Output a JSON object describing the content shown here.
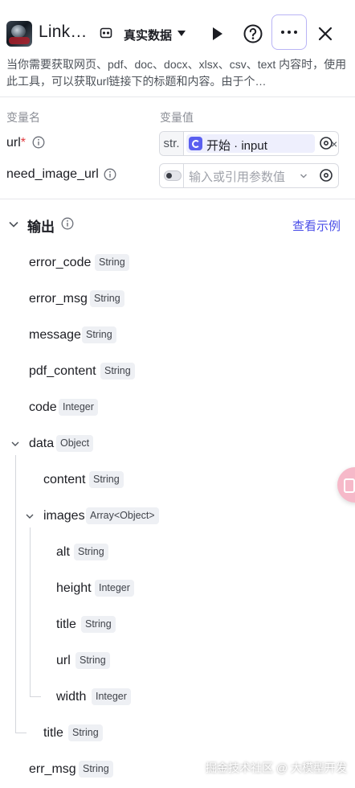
{
  "header": {
    "title": "Link…",
    "data_mode": "真实数据",
    "description": "当你需要获取网页、pdf、doc、docx、xlsx、csv、text 内容时，使用此工具，可以获取url链接下的标题和内容。由于个…"
  },
  "inputs": {
    "col_name": "变量名",
    "col_value": "变量值",
    "rows": [
      {
        "name": "url",
        "required": "*",
        "type_tag": "str.",
        "ref_text": "开始 · input",
        "clear": "×"
      },
      {
        "name": "need_image_url",
        "placeholder": "输入或引用参数值"
      }
    ]
  },
  "output": {
    "title": "输出",
    "see_example": "查看示例",
    "items": [
      {
        "name": "error_code",
        "type": "String"
      },
      {
        "name": "error_msg",
        "type": "String"
      },
      {
        "name": "message",
        "type": "String"
      },
      {
        "name": "pdf_content",
        "type": "String"
      },
      {
        "name": "code",
        "type": "Integer"
      },
      {
        "name": "data",
        "type": "Object"
      },
      {
        "name": "content",
        "type": "String"
      },
      {
        "name": "images",
        "type": "Array<Object>"
      },
      {
        "name": "alt",
        "type": "String"
      },
      {
        "name": "height",
        "type": "Integer"
      },
      {
        "name": "title",
        "type": "String"
      },
      {
        "name": "url",
        "type": "String"
      },
      {
        "name": "width",
        "type": "Integer"
      },
      {
        "name": "title",
        "type": "String"
      },
      {
        "name": "err_msg",
        "type": "String"
      }
    ]
  },
  "watermark": "掘金技术社区 @ 大模型开发",
  "colors": {
    "accent": "#4a4ee8",
    "required": "#e0393e",
    "ref_icon": "#5a5ff0"
  }
}
